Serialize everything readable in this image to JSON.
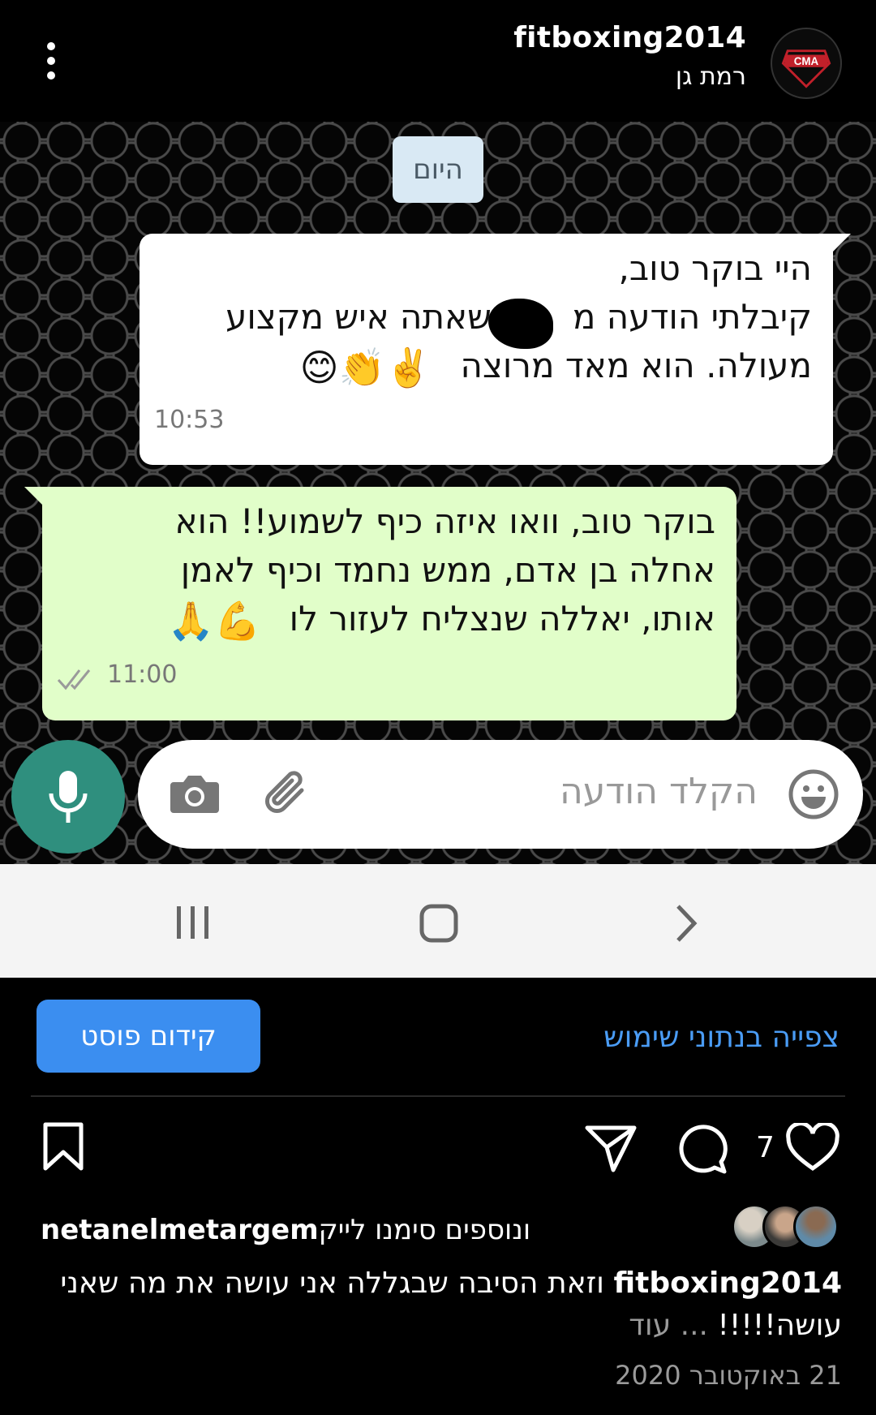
{
  "header": {
    "account_name": "fitboxing2014",
    "location": "רמת גן",
    "avatar_text": "CMA"
  },
  "chat": {
    "date_label": "היום",
    "incoming": {
      "line1": "היי בוקר טוב,",
      "line2_right": "קיבלתי הודעה מ",
      "line2_left": "שאתה איש מקצוע",
      "line3_text": "מעולה. הוא מאד מרוצה",
      "line3_emoji": "✌️👏😊",
      "time": "10:53"
    },
    "outgoing": {
      "line1": "בוקר טוב, וואו איזה כיף לשמוע!! הוא",
      "line2": "אחלה בן אדם, ממש נחמד וכיף לאמן",
      "line3_text": "אותו, יאללה שנצליח לעזור לו",
      "line3_emoji": "💪🙏",
      "time": "11:00",
      "status": "read"
    },
    "input_placeholder": "הקלד הודעה",
    "colors": {
      "incoming_bg": "#ffffff",
      "outgoing_bg": "#e1fec9",
      "mic_bg": "#2f8f7e",
      "date_pill_bg": "#d9e9f4"
    }
  },
  "post": {
    "promote_label": "קידום פוסט",
    "insights_label": "צפייה בנתוני שימוש",
    "like_count": "7",
    "liked_by_user": "netanelmetargem",
    "liked_by_text": " ונוספים סימנו לייק",
    "caption_user": "fitboxing2014",
    "caption_text": " וזאת הסיבה שבגללה אני עושה את מה שאני עושה!!!!!",
    "caption_more": "... עוד",
    "date": "21 באוקטובר 2020",
    "accent": "#3b8ef0"
  },
  "icons": {
    "header": [
      "more-vertical-icon"
    ],
    "chat": [
      "mic-icon",
      "camera-icon",
      "paperclip-icon",
      "emoji-icon",
      "double-check-icon"
    ],
    "navbar": [
      "recents-icon",
      "home-icon",
      "back-icon"
    ],
    "actions": [
      "heart-icon",
      "comment-icon",
      "share-icon",
      "bookmark-icon"
    ]
  }
}
